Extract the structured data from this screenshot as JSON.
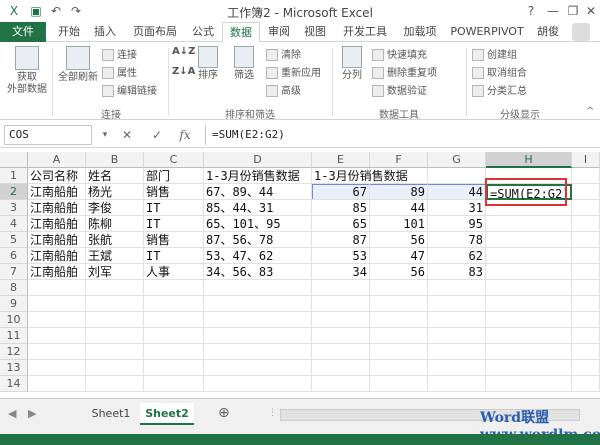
{
  "window": {
    "title": "工作簿2 - Microsoft Excel",
    "minimize": "—",
    "restore": "❐",
    "close": "✕"
  },
  "tabs": [
    "文件",
    "开始",
    "插入",
    "页面布局",
    "公式",
    "数据",
    "审阅",
    "视图",
    "开发工具",
    "加载项",
    "POWERPIVOT",
    "胡俊"
  ],
  "active_tab": "数据",
  "ribbon": {
    "get_external_label": "获取\n外部数据",
    "refresh_all_label": "全部刷新",
    "connections": "连接",
    "properties": "属性",
    "edit_links": "编辑链接",
    "group_connections": "连接",
    "sort_label": "排序",
    "filter_label": "筛选",
    "clear": "清除",
    "reapply": "重新应用",
    "advanced": "高级",
    "group_sort_filter": "排序和筛选",
    "text_to_columns": "分列",
    "flash_fill": "快速填充",
    "remove_duplicates": "删除重复项",
    "data_validation": "数据验证",
    "group_data_tools": "数据工具",
    "group": "创建组",
    "ungroup": "取消组合",
    "subtotal": "分类汇总",
    "group_outline": "分级显示"
  },
  "formula_bar": {
    "name_box": "COS",
    "cancel": "✕",
    "enter": "✓",
    "fx": "fx",
    "formula": "=SUM(E2:G2)"
  },
  "columns": [
    "A",
    "B",
    "C",
    "D",
    "E",
    "F",
    "G",
    "H",
    "I"
  ],
  "rows": [
    "1",
    "2",
    "3",
    "4",
    "5",
    "6",
    "7",
    "8",
    "9",
    "10",
    "11",
    "12",
    "13",
    "14"
  ],
  "cells": {
    "r1": [
      "公司名称",
      "姓名",
      "部门",
      "1-3月份销售数据",
      "1-3月份销售数据",
      "",
      "",
      ""
    ],
    "r2": [
      "江南船舶",
      "杨光",
      "销售",
      "67、89、44",
      "67",
      "89",
      "44",
      "=SUM(E2:G2)"
    ],
    "r3": [
      "江南船舶",
      "李俊",
      "IT",
      "85、44、31",
      "85",
      "44",
      "31",
      ""
    ],
    "r4": [
      "江南船舶",
      "陈柳",
      "IT",
      "65、101、95",
      "65",
      "101",
      "95",
      ""
    ],
    "r5": [
      "江南船舶",
      "张航",
      "销售",
      "87、56、78",
      "87",
      "56",
      "78",
      ""
    ],
    "r6": [
      "江南船舶",
      "王斌",
      "IT",
      "53、47、62",
      "53",
      "47",
      "62",
      ""
    ],
    "r7": [
      "江南船舶",
      "刘军",
      "人事",
      "34、56、83",
      "34",
      "56",
      "83",
      ""
    ]
  },
  "sheets": [
    "Sheet1",
    "Sheet2"
  ],
  "active_sheet": "Sheet2",
  "add_sheet": "⊕",
  "watermark": "Word联盟 www.wordlm.com",
  "colors": {
    "accent": "#217346",
    "highlight_box": "#e03030"
  }
}
